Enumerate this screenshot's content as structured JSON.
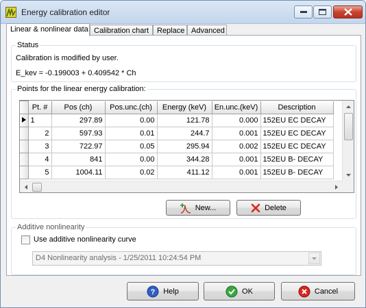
{
  "window": {
    "title": "Energy calibration editor"
  },
  "tabs": [
    {
      "label": "Linear & nonlinear data",
      "active": true
    },
    {
      "label": "Calibration chart",
      "active": false
    },
    {
      "label": "Replace",
      "active": false
    },
    {
      "label": "Advanced",
      "active": false
    }
  ],
  "status": {
    "legend": "Status",
    "message": "Calibration is modified by user.",
    "equation": "E_kev = -0.199003 + 0.409542 * Ch"
  },
  "points": {
    "legend": "Points for the linear energy calibration:",
    "columns": [
      "Pt. #",
      "Pos (ch)",
      "Pos.unc.(ch)",
      "Energy (keV)",
      "En.unc.(keV)",
      "Description"
    ],
    "rows": [
      [
        "1",
        "297.89",
        "0.00",
        "121.78",
        "0.000",
        "152EU EC DECAY"
      ],
      [
        "2",
        "597.93",
        "0.01",
        "244.7",
        "0.001",
        "152EU EC DECAY"
      ],
      [
        "3",
        "722.97",
        "0.05",
        "295.94",
        "0.002",
        "152EU EC DECAY"
      ],
      [
        "4",
        "841",
        "0.00",
        "344.28",
        "0.001",
        "152EU B- DECAY"
      ],
      [
        "5",
        "1004.11",
        "0.02",
        "411.12",
        "0.001",
        "152EU B- DECAY"
      ]
    ],
    "new_button": "New...",
    "delete_button": "Delete"
  },
  "additive": {
    "legend": "Additive nonlinearity",
    "checkbox_label": "Use additive nonlinearity curve",
    "checked": false,
    "combo_value": "D4 Nonlinearity analysis - 1/25/2011 10:24:54 PM"
  },
  "footer": {
    "help": "Help",
    "ok": "OK",
    "cancel": "Cancel"
  }
}
